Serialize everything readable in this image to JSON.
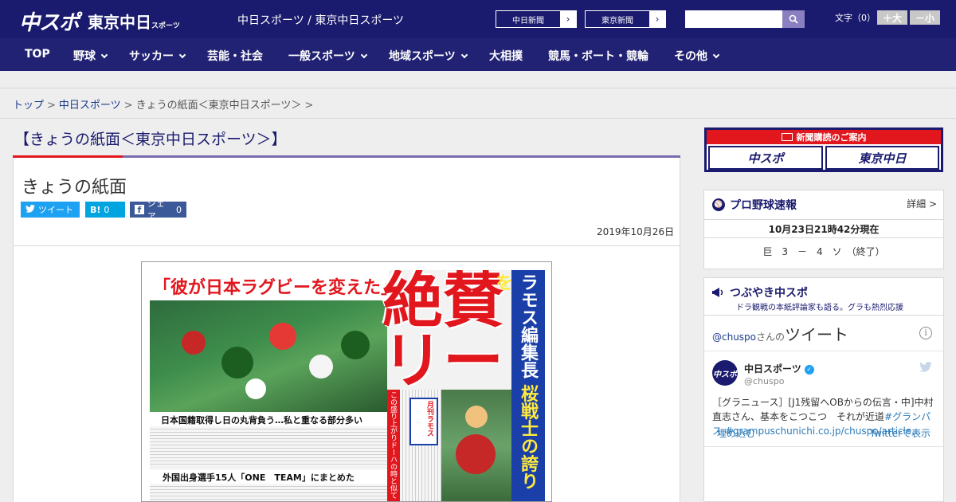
{
  "header": {
    "logo_chuspo": "中スポ",
    "logo_tokyo": "東京中日",
    "logo_tokyo_small": "スポーツ",
    "sites": "中日スポーツ / 東京中日スポーツ",
    "ext_links": [
      {
        "label": "中日新聞"
      },
      {
        "label": "東京新聞"
      }
    ],
    "search_placeholder": "",
    "font_size_label": "文字（0）",
    "font_larger": "＋大",
    "font_smaller": "－小"
  },
  "nav": {
    "items": [
      {
        "label": "TOP",
        "dropdown": false
      },
      {
        "label": "野球",
        "dropdown": true
      },
      {
        "label": "サッカー",
        "dropdown": true
      },
      {
        "label": "芸能・社会",
        "dropdown": false
      },
      {
        "label": "一般スポーツ",
        "dropdown": true
      },
      {
        "label": "地域スポーツ",
        "dropdown": true
      },
      {
        "label": "大相撲",
        "dropdown": false
      },
      {
        "label": "競馬・ボート・競輪",
        "dropdown": false
      },
      {
        "label": "その他",
        "dropdown": true
      }
    ]
  },
  "breadcrumb": {
    "items": [
      "トップ",
      "中日スポーツ",
      "きょうの紙面＜東京中日スポーツ＞"
    ],
    "separator": ">"
  },
  "page": {
    "heading": "【きょうの紙面＜東京中日スポーツ＞】",
    "title": "きょうの紙面",
    "share": {
      "tweet": "ツイート",
      "hatena_icon": "B!",
      "hatena_count": "0",
      "facebook": "シェア",
      "facebook_count": "0"
    },
    "date": "2019年10月26日"
  },
  "newspaper": {
    "headline": "「彼が日本ラグビーを変えた」",
    "big_text": "絶賛リーチ",
    "vertical_title": "ラモス編集長",
    "vertical_sub": "桜戦士の誇りを",
    "sub1": "日本国籍取得し日の丸背負う…私と重なる部分多い",
    "sub2": "外国出身選手15人「ONE　TEAM」にまとめた",
    "red_vertical": "この盛り上がりドーハの時と似て",
    "box_label": "月刊ラモス"
  },
  "sidebar": {
    "subscription": {
      "title": "新聞購読のご案内",
      "btn1": "中スポ",
      "btn2": "東京中日"
    },
    "baseball": {
      "title": "プロ野球速報",
      "detail": "詳細 >",
      "time": "10月23日21時42分現在",
      "score": "巨　3　－　4　ソ　（終了）"
    },
    "tweets": {
      "title": "つぶやき中スポ",
      "subtitle": "ドラ観戦の本紙評論家も語る。グラも熱烈応援",
      "header_handle": "@chuspo",
      "header_san": "さんの",
      "header_tweet": "ツイート",
      "name": "中日スポーツ",
      "handle": "@chuspo",
      "text_plain": "［グラニュース］[J1残留へOBからの伝言・中]中村直志さん、基本をこつこつ　それが近道",
      "text_link": "#グランパス #grampuschunichi.co.jp/chuspo/article…",
      "embed": "埋め込む",
      "view_on_twitter": "Twitterで表示"
    }
  },
  "colors": {
    "header_bg": "#1a1a6e",
    "nav_bg": "#222274",
    "accent_red": "#e2171e",
    "accent_purple": "#7a6bb0",
    "twitter_blue": "#1da1f2",
    "facebook_blue": "#3b5998",
    "hatena_blue": "#00a4de"
  }
}
